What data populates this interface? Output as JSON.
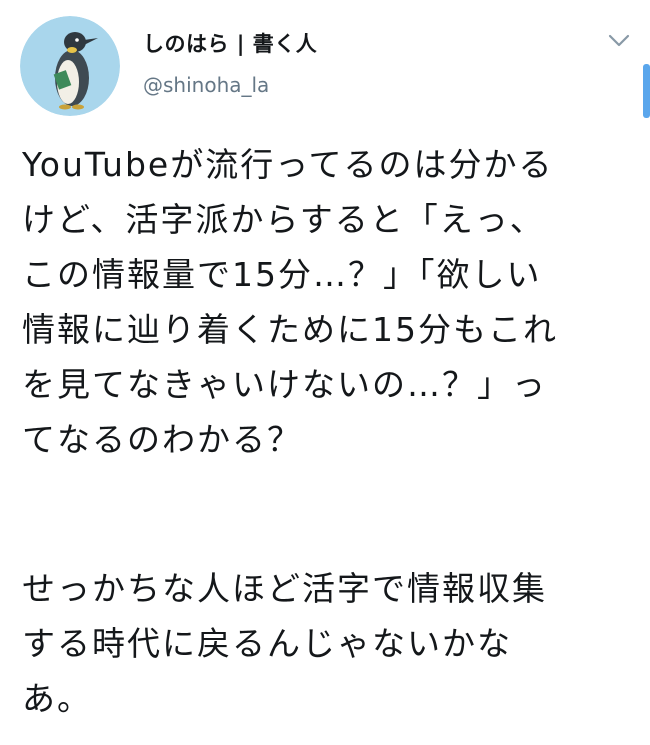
{
  "author": {
    "display_name": "しのはら | 書く人",
    "handle": "@shinoha_la",
    "avatar_icon": "penguin-avatar"
  },
  "tweet": {
    "paragraph_1": "YouTubeが流行ってるのは分かる\nけど、活字派からすると「えっ、\nこの情報量で15分…？」「欲しい\n情報に辿り着くために15分もこれ\nを見てなきゃいけないの…？」っ\nてなるのわかる？",
    "paragraph_2": "せっかちな人ほど活字で情報収集\nする時代に戻るんじゃないかな\nあ。"
  },
  "menu": {
    "icon": "chevron-down-icon"
  },
  "colors": {
    "text": "#14171a",
    "secondary_text": "#657786",
    "avatar_bg": "#a9d6ec",
    "scrollbar": "#5aa6ec"
  }
}
